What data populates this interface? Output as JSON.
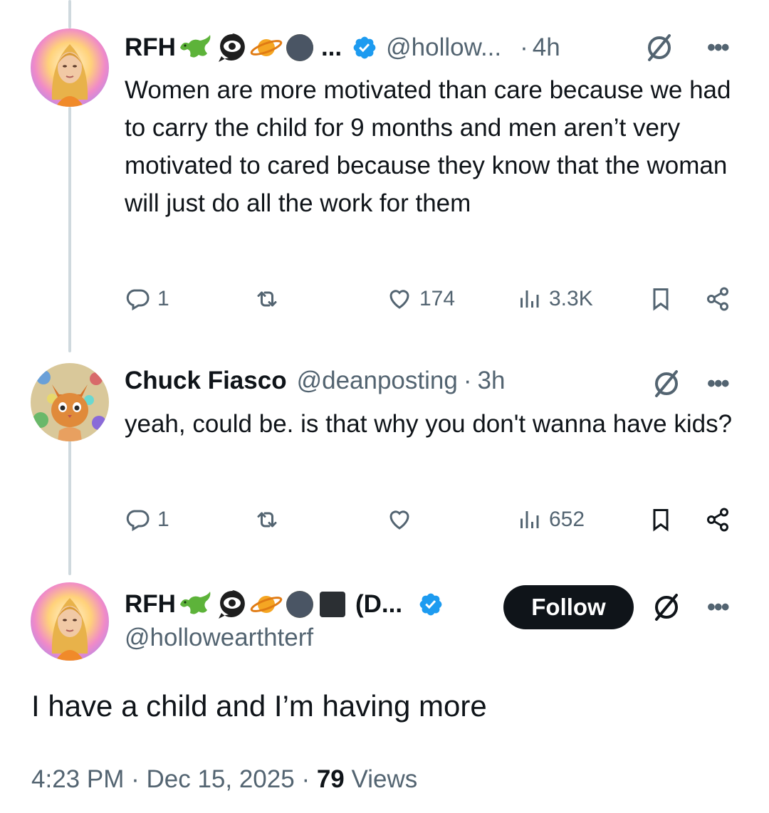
{
  "tweet1": {
    "name": "RFH",
    "emojis": [
      "lizard-emoji",
      "eye-speech-emoji",
      "ringed-planet-emoji",
      "moon-emoji"
    ],
    "name_overflow": "...",
    "handle": "@hollow...",
    "separator": "·",
    "time": "4h",
    "text": "Women are more motivated than care because we had to carry the child for 9 months and men aren’t very motivated to cared because they know that the woman will just do all the work for them",
    "replies": "1",
    "likes": "174",
    "views": "3.3K"
  },
  "tweet2": {
    "name": "Chuck Fiasco",
    "handle": "@deanposting",
    "separator": "·",
    "time": "3h",
    "text": "yeah, could be. is that why you don't wanna have kids?",
    "replies": "1",
    "views": "652"
  },
  "main": {
    "name": "RFH",
    "emojis": [
      "lizard-emoji",
      "eye-speech-emoji",
      "ringed-planet-emoji",
      "moon-emoji",
      "black-square-emoji"
    ],
    "name_suffix": "(D...",
    "handle": "@hollowearthterf",
    "follow_label": "Follow",
    "text": "I have a child and I’m having more",
    "time": "4:23 PM",
    "separator1": "·",
    "date": "Dec 15, 2025",
    "separator2": "·",
    "views_count": "79",
    "views_label": "Views"
  },
  "colors": {
    "verified": "#1d9bf0",
    "muted": "#536471",
    "text": "#0f1419",
    "thread_line": "#cfd9de"
  }
}
